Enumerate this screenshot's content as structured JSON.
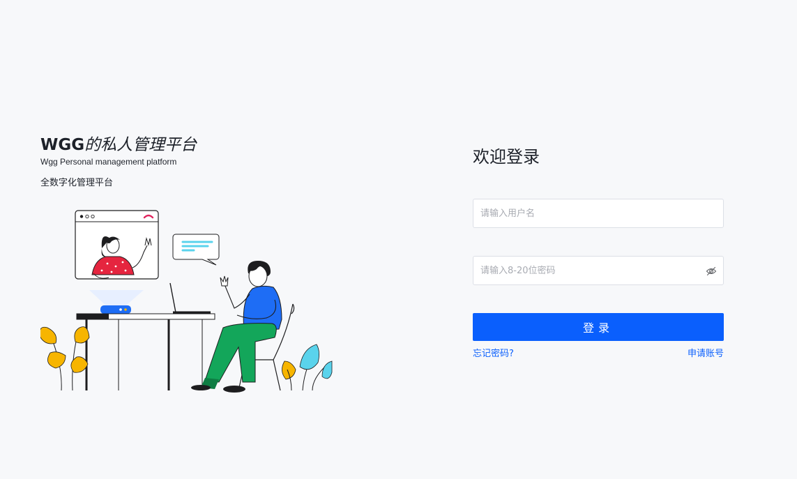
{
  "brand": {
    "title_latin": "WGG",
    "title_cn": "的私人管理平台",
    "subtitle": "Wgg Personal management platform",
    "description": "全数字化管理平台"
  },
  "login": {
    "title": "欢迎登录",
    "username_placeholder": "请输入用户名",
    "password_placeholder": "请输入8-20位密码",
    "password_toggle_icon": "eye-off-icon",
    "submit_label": "登录",
    "forgot_link": "忘记密码?",
    "apply_link": "申请账号"
  },
  "colors": {
    "primary": "#0a5ffd",
    "background": "#f7f8fa",
    "text": "#1d2129",
    "placeholder": "#a8abb2"
  }
}
